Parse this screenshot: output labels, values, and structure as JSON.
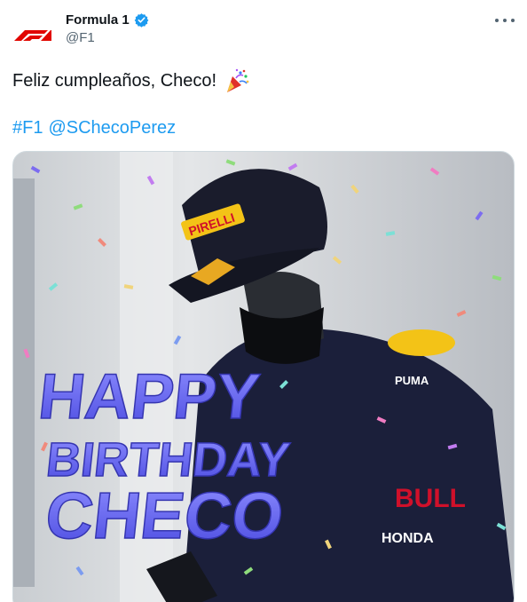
{
  "account": {
    "name": "Formula 1",
    "handle": "@F1",
    "verified": true,
    "logo_icon": "formula1-logo",
    "more_icon": "more-horizontal-icon"
  },
  "tweet": {
    "text": "Feliz cumpleaños, Checo!",
    "emoji_icon": "party-popper-icon",
    "hashtag": "#F1",
    "mention": "@SChecoPerez"
  },
  "media": {
    "overlay_lines": [
      "HAPPY",
      "BIRTHDAY",
      "CHECO"
    ],
    "cap_brand": "PIRELLI",
    "suit_logos": [
      "PUMA",
      "HONDA",
      "BULL"
    ]
  },
  "colors": {
    "brand_red": "#e10600",
    "link_blue": "#1d9bf0",
    "text_primary": "#0f1419",
    "text_secondary": "#536471",
    "overlay_purple": "#5a5af0",
    "suit_navy": "#1b1f3a"
  }
}
